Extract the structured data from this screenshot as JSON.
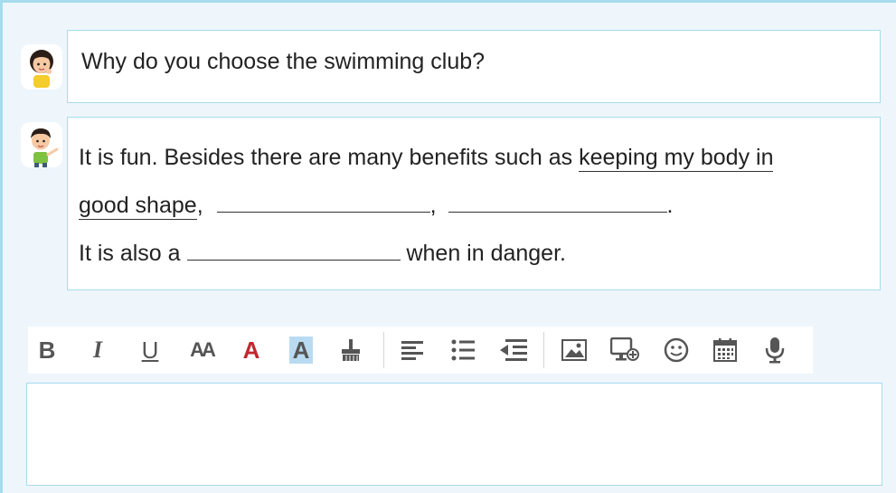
{
  "dialogue": {
    "question": "Why do you choose the swimming club?",
    "answer": {
      "line1_prefix": "It is fun. Besides there are many benefits such as ",
      "line1_underlined": "keeping my body in",
      "line2_underlined": "good shape",
      "line2_sep1": ",",
      "line2_sep2": ",",
      "line2_end": ".",
      "line3_prefix": "It is also a ",
      "line3_suffix": "when in danger."
    }
  },
  "toolbar": {
    "buttons": [
      {
        "name": "bold-icon",
        "glyph": "B"
      },
      {
        "name": "italic-icon",
        "glyph": "I"
      },
      {
        "name": "underline-icon",
        "glyph": "U"
      },
      {
        "name": "font-size-icon",
        "glyph": "AA"
      },
      {
        "name": "font-color-icon",
        "glyph": "A"
      },
      {
        "name": "highlight-color-icon",
        "glyph": "A"
      },
      {
        "name": "clear-format-icon"
      },
      {
        "name": "align-left-icon"
      },
      {
        "name": "bulleted-list-icon"
      },
      {
        "name": "outdent-icon"
      },
      {
        "name": "insert-image-icon"
      },
      {
        "name": "insert-media-icon"
      },
      {
        "name": "emoji-icon"
      },
      {
        "name": "calendar-icon"
      },
      {
        "name": "microphone-icon"
      }
    ]
  },
  "colors": {
    "border": "#a6dced",
    "background": "#eef6fc",
    "font_color_red": "#c0282e",
    "highlight_bg": "#b9dbf2",
    "icon_gray": "#555555"
  },
  "editor": {
    "value": ""
  }
}
